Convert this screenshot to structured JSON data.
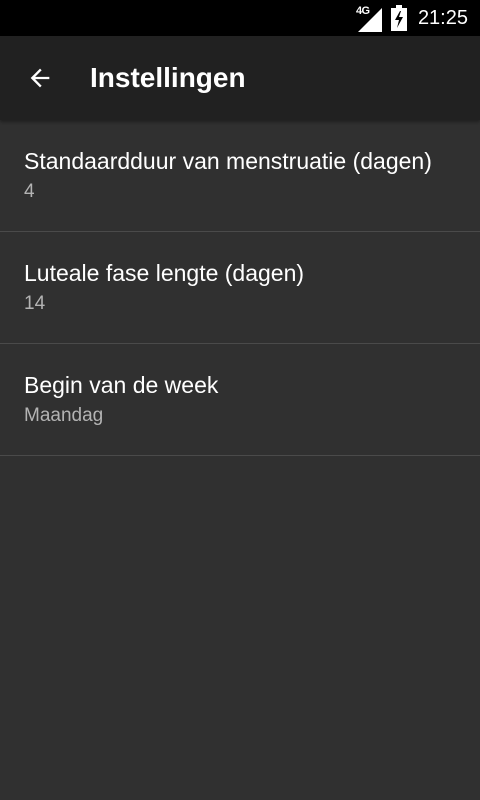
{
  "status_bar": {
    "network": "4G",
    "time": "21:25"
  },
  "app_bar": {
    "title": "Instellingen",
    "back_icon": "arrow-back-icon"
  },
  "settings": {
    "items": [
      {
        "title": "Standaardduur van menstruatie (dagen)",
        "summary": "4"
      },
      {
        "title": "Luteale fase lengte (dagen)",
        "summary": "14"
      },
      {
        "title": "Begin van de week",
        "summary": "Maandag"
      }
    ]
  },
  "colors": {
    "background": "#303030",
    "app_bar": "#212121",
    "status_bar": "#000000",
    "primary_text": "#ffffff",
    "secondary_text": "#b3b3b3",
    "divider": "#4a4a4a"
  }
}
